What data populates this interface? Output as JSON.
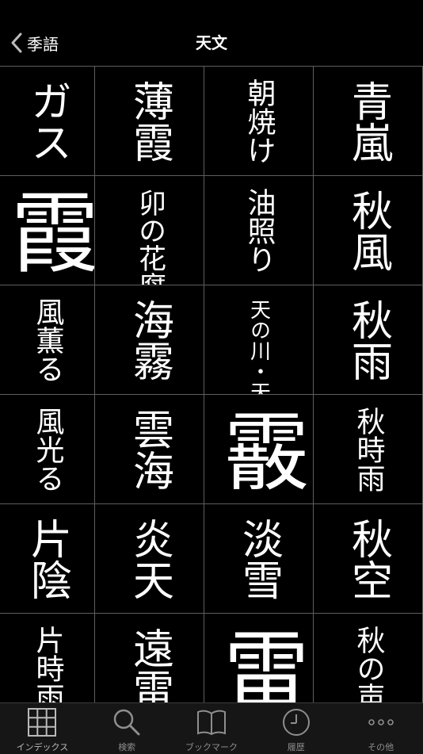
{
  "nav": {
    "back_label": "季語",
    "title": "天文"
  },
  "grid": {
    "cells": [
      {
        "text": "ガス"
      },
      {
        "text": "薄霞"
      },
      {
        "text": "朝焼け"
      },
      {
        "text": "青嵐"
      },
      {
        "text": "霞"
      },
      {
        "text": "卯の花腐し"
      },
      {
        "text": "油照り"
      },
      {
        "text": "秋風"
      },
      {
        "text": "風薫る"
      },
      {
        "text": "海霧"
      },
      {
        "text": "天の川・天漢・銀漢"
      },
      {
        "text": "秋雨"
      },
      {
        "text": "風光る"
      },
      {
        "text": "雲海"
      },
      {
        "text": "霰"
      },
      {
        "text": "秋時雨"
      },
      {
        "text": "片陰"
      },
      {
        "text": "炎天"
      },
      {
        "text": "淡雪"
      },
      {
        "text": "秋空"
      },
      {
        "text": "片時雨"
      },
      {
        "text": "遠雷"
      },
      {
        "text": "雷"
      },
      {
        "text": "秋の声"
      }
    ]
  },
  "tabbar": {
    "tabs": [
      {
        "label": "インデックス",
        "icon": "grid-icon"
      },
      {
        "label": "検索",
        "icon": "search-icon"
      },
      {
        "label": "ブックマーク",
        "icon": "book-icon"
      },
      {
        "label": "履歴",
        "icon": "clock-icon"
      },
      {
        "label": "その他",
        "icon": "more-icon"
      }
    ]
  }
}
